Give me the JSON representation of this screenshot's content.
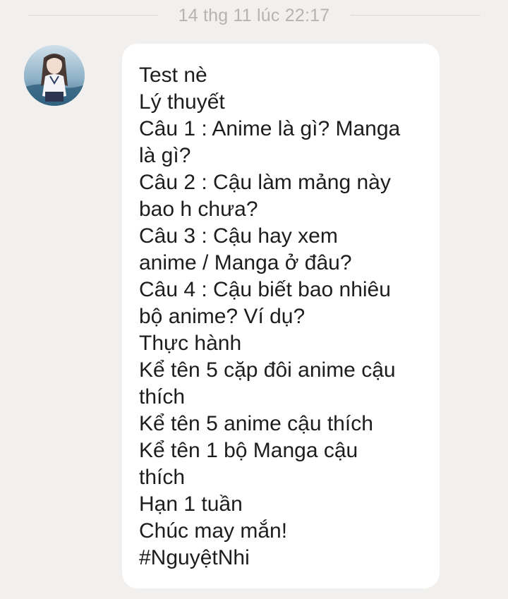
{
  "chat": {
    "timestamp": "14 thg 11 lúc 22:17",
    "message": {
      "lines": [
        "Test nè",
        "Lý thuyết",
        "Câu 1 : Anime là gì? Manga",
        "là gì?",
        "Câu 2 : Cậu làm mảng này",
        "bao h chưa?",
        "Câu 3 : Cậu hay xem",
        "anime / Manga ở đâu?",
        "Câu 4 : Cậu biết bao nhiêu",
        "bộ anime? Ví dụ?",
        "Thực hành",
        "Kể tên 5 cặp đôi anime cậu",
        "thích",
        "Kể tên 5 anime cậu thích",
        "Kể tên 1 bộ Manga cậu",
        "thích",
        "Hạn 1 tuần",
        "Chúc may mắn!",
        "#NguyệtNhi"
      ]
    }
  },
  "colors": {
    "background": "#f2f0ef",
    "bubble": "#ffffff",
    "text": "#1d1d1d",
    "timestamp": "#b7b3b0"
  }
}
